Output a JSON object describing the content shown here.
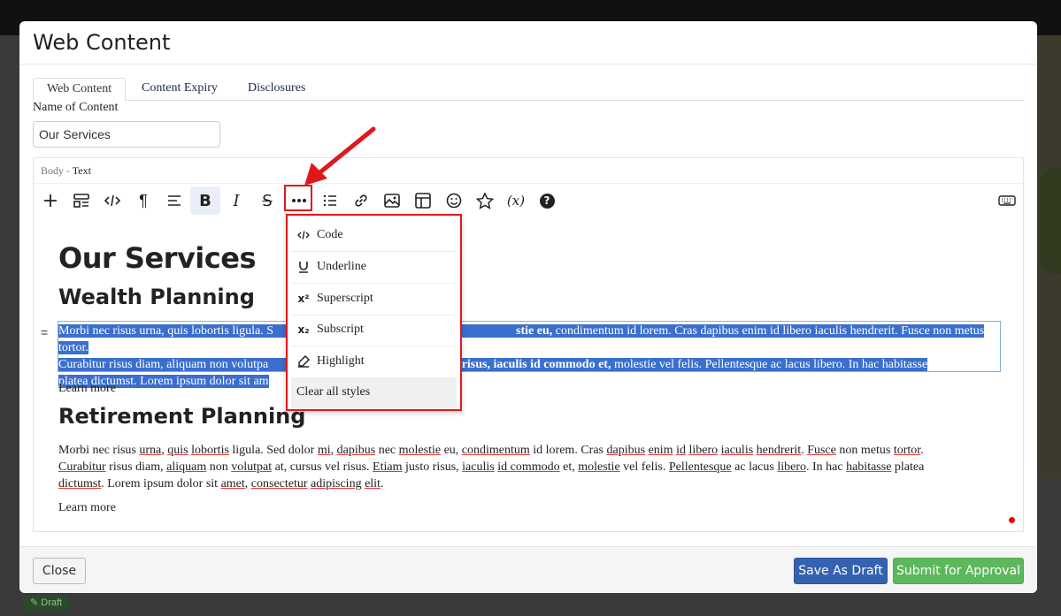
{
  "background": {
    "draft_badge": "Draft"
  },
  "modal": {
    "title": "Web Content",
    "tabs": [
      "Web Content",
      "Content Expiry",
      "Disclosures"
    ],
    "name_label": "Name of Content",
    "name_value": "Our Services",
    "body_label": "Body -",
    "body_type": "Text"
  },
  "toolbar": {
    "buttons": [
      "plus-icon",
      "block-icon",
      "code-icon",
      "paragraph-icon",
      "align-icon",
      "bold-icon",
      "italic-icon",
      "strikethrough-icon",
      "more-icon",
      "list-icon",
      "link-icon",
      "image-icon",
      "table-icon",
      "emoji-icon",
      "star-icon",
      "variable-icon",
      "help-icon",
      "keyboard-icon"
    ],
    "bold_glyph": "B",
    "italic_glyph": "I",
    "strike_glyph": "S",
    "paragraph_glyph": "¶",
    "variable_glyph": "(x)",
    "help_glyph": "?"
  },
  "content": {
    "h1": "Our Services",
    "h2_wealth": "Wealth Planning",
    "h2_retirement": "Retirement Planning",
    "learn_more": "Learn more",
    "drag_handle": "="
  },
  "para1": {
    "line1_a": "Morbi nec risus urna, quis lobortis ligula. S",
    "line1_b": "stie eu,",
    "line1_c": " condimentum id lorem. Cras dapibus enim id libero iaculis hendrerit. Fusce non metus tortor.",
    "line2_a": "Curabitur risus diam, aliquam non volutpa",
    "line2_b": " risus, iaculis id commodo et,",
    "line2_c": " molestie vel felis. Pellentesque ac lacus libero. In hac habitasse",
    "line3_a": "platea dictumst. Lorem ipsum dolor sit am"
  },
  "para2": {
    "w01": "Morbi nec risus ",
    "w02": "urna",
    "w03": ", ",
    "w04": "quis",
    "w05": " ",
    "w06": "lobortis",
    "w07": " ligula. Sed dolor ",
    "w08": "mi",
    "w09": ", ",
    "w10": "dapibus",
    "w11": " nec ",
    "w12": "molestie",
    "w13": " eu, ",
    "w14": "condimentum",
    "w15": " id lorem. Cras ",
    "w16": "dapibus",
    "w17": " ",
    "w18": "enim",
    "w19": " ",
    "w20": "id",
    "w21": " ",
    "w22": "libero",
    "w23": " ",
    "w24": "iaculis",
    "w25": " ",
    "w26": "hendrerit",
    "w27": ". ",
    "w28": "Fusce",
    "w29": " non metus ",
    "w30": "tortor",
    "w31": ".",
    "x01": "Curabitur",
    "x02": " risus diam, ",
    "x03": "aliquam",
    "x04": " non ",
    "x05": "volutpat",
    "x06": " at, cursus vel risus. ",
    "x07": "Etiam",
    "x08": " justo risus, ",
    "x09": "iaculis",
    "x10": " ",
    "x11": "id commodo",
    "x12": " et, ",
    "x13": "molestie",
    "x14": " vel felis. ",
    "x15": "Pellentesque",
    "x16": " ac lacus ",
    "x17": "libero",
    "x18": ". In hac ",
    "x19": "habitasse",
    "x20": " platea",
    "y01": "dictumst",
    "y02": ". Lorem ipsum dolor sit ",
    "y03": "amet",
    "y04": ", ",
    "y05": "consectetur",
    "y06": " ",
    "y07": "adipiscing",
    "y08": " ",
    "y09": "elit",
    "y10": "."
  },
  "menu": {
    "items": [
      {
        "icon": "code-icon",
        "label": "Code"
      },
      {
        "icon": "underline-icon",
        "label": "Underline"
      },
      {
        "icon": "superscript-icon",
        "label": "Superscript"
      },
      {
        "icon": "subscript-icon",
        "label": "Subscript"
      },
      {
        "icon": "highlight-icon",
        "label": "Highlight"
      },
      {
        "icon": "",
        "label": "Clear all styles"
      }
    ]
  },
  "footer": {
    "close": "Close",
    "save_draft": "Save As Draft",
    "submit": "Submit for Approval"
  },
  "colors": {
    "accent_red": "#e0181e",
    "selection": "#3a6fcf",
    "draft_button": "#3461b0",
    "submit_button": "#5cb85c"
  }
}
